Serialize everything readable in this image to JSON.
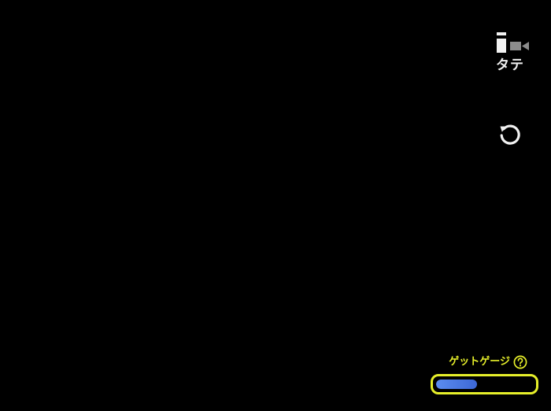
{
  "orientation_toggle": {
    "label": "タテ",
    "icon": "orientation-portrait-icon"
  },
  "rotate_button": {
    "icon": "rotate-ccw-icon"
  },
  "gauge": {
    "title": "ゲットゲージ",
    "help_icon": "question-circle-icon",
    "progress": 0.42,
    "colors": {
      "border": "#e6ef2a",
      "fill_start": "#5b8cf0",
      "fill_end": "#3d68d6",
      "title": "#e6ef2a"
    }
  }
}
